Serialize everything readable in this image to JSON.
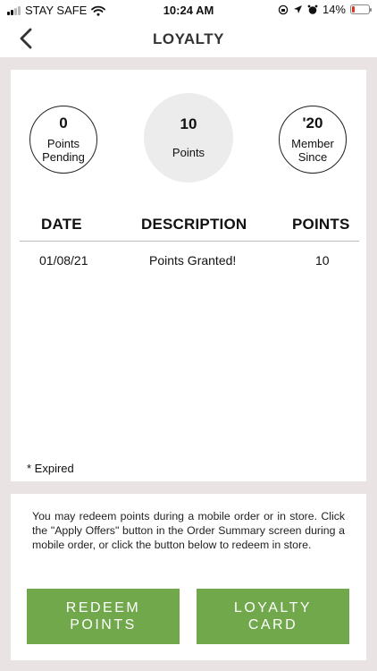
{
  "status_bar": {
    "carrier": "STAY SAFE",
    "time": "10:24 AM",
    "battery_percent": "14%",
    "battery_level": 0.14,
    "battery_color": "#e0322b"
  },
  "nav": {
    "back_icon": "chevron-left-icon",
    "title": "LOYALTY"
  },
  "stats": {
    "pending": {
      "value": "0",
      "label": "Points\nPending"
    },
    "points": {
      "value": "10",
      "label": "Points"
    },
    "member": {
      "value": "'20",
      "label": "Member\nSince"
    }
  },
  "table": {
    "headers": {
      "date": "DATE",
      "description": "DESCRIPTION",
      "points": "POINTS"
    },
    "rows": [
      {
        "date": "01/08/21",
        "description": "Points Granted!",
        "points": "10"
      }
    ]
  },
  "expired_note": "* Expired",
  "redeem_info": "You may redeem points during a mobile order or in store. Click the \"Apply Offers\" button in the Order Summary screen during a mobile order, or click the button below to redeem in store.",
  "buttons": {
    "redeem": {
      "line1": "REDEEM",
      "line2": "POINTS"
    },
    "loyalty_card": {
      "line1": "LOYALTY",
      "line2": "CARD"
    }
  },
  "colors": {
    "accent_green": "#72a84c",
    "page_background": "#e9e4e3"
  }
}
